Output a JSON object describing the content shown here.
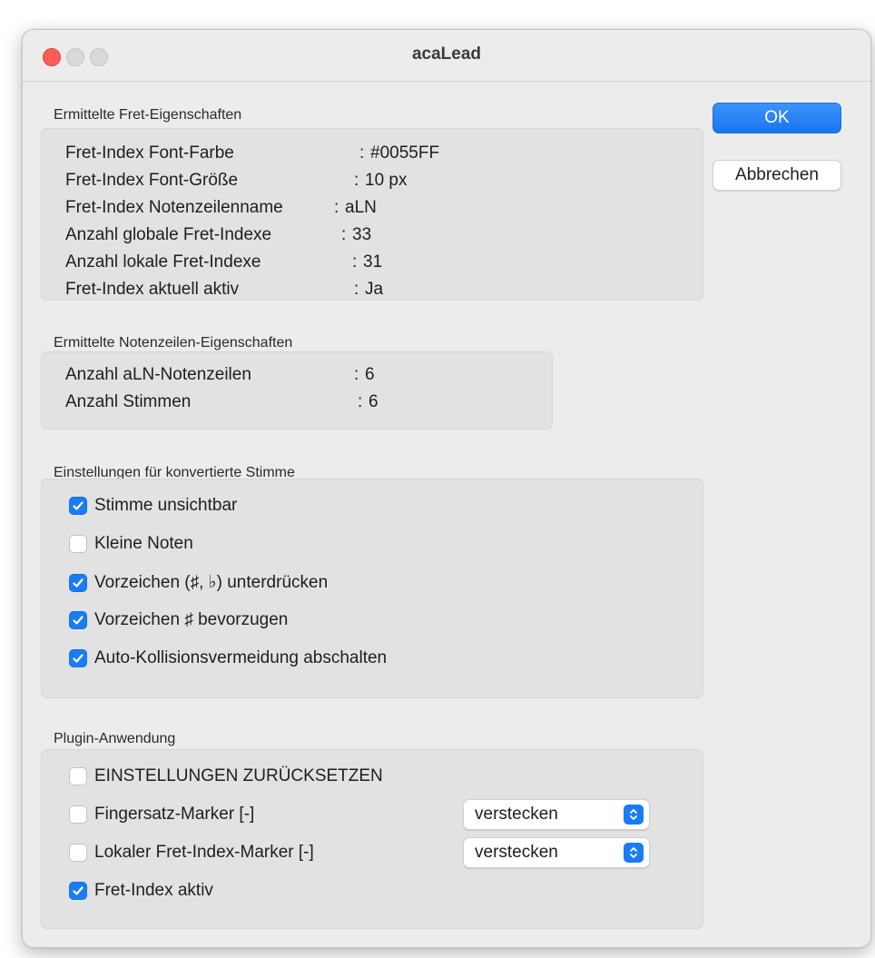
{
  "window": {
    "title": "acaLead"
  },
  "buttons": {
    "ok": "OK",
    "cancel": "Abbrechen"
  },
  "fret_section": {
    "title": "Ermittelte Fret-Eigenschaften",
    "rows": [
      {
        "label": "Fret-Index Font-Farbe",
        "sep": ":",
        "value": "#0055FF"
      },
      {
        "label": "Fret-Index Font-Größe",
        "sep": ":",
        "value": "10 px"
      },
      {
        "label": "Fret-Index Notenzeilenname",
        "sep": ":",
        "value": "aLN"
      },
      {
        "label": "Anzahl globale Fret-Indexe",
        "sep": ":",
        "value": "33"
      },
      {
        "label": "Anzahl lokale Fret-Indexe",
        "sep": ":",
        "value": "31"
      },
      {
        "label": "Fret-Index aktuell aktiv",
        "sep": ":",
        "value": "Ja"
      }
    ]
  },
  "staff_section": {
    "title": "Ermittelte Notenzeilen-Eigenschaften",
    "rows": [
      {
        "label": "Anzahl aLN-Notenzeilen",
        "sep": ":",
        "value": "6"
      },
      {
        "label": "Anzahl Stimmen",
        "sep": ":",
        "value": "6"
      }
    ]
  },
  "voice_section": {
    "title": "Einstellungen für konvertierte Stimme",
    "options": [
      {
        "label": "Stimme unsichtbar",
        "checked": true
      },
      {
        "label": "Kleine Noten",
        "checked": false
      },
      {
        "label": "Vorzeichen (♯, ♭) unterdrücken",
        "checked": true
      },
      {
        "label": "Vorzeichen ♯ bevorzugen",
        "checked": true
      },
      {
        "label": "Auto-Kollisionsvermeidung abschalten",
        "checked": true
      }
    ]
  },
  "plugin_section": {
    "title": "Plugin-Anwendung",
    "options": [
      {
        "label": "EINSTELLUNGEN ZURÜCKSETZEN",
        "checked": false
      },
      {
        "label": "Fingersatz-Marker [-]",
        "checked": false,
        "select": "verstecken"
      },
      {
        "label": "Lokaler Fret-Index-Marker [-]",
        "checked": false,
        "select": "verstecken"
      },
      {
        "label": "Fret-Index aktiv",
        "checked": true
      }
    ]
  },
  "colors": {
    "accent": "#1a7cf4",
    "close": "#fe5f57"
  },
  "icons": {
    "check": "checkmark-icon",
    "select": "chevron-updown-icon"
  }
}
